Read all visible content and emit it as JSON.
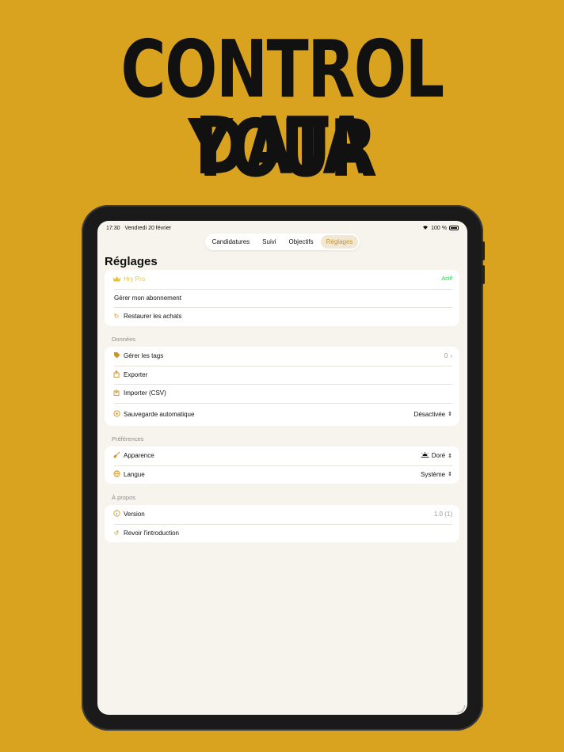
{
  "headline": {
    "line1": "CONTROL YOUR",
    "line2": "DATA"
  },
  "status_bar": {
    "time": "17:30",
    "date": "Vendredi 20 février",
    "battery": "100 %"
  },
  "tabs": [
    {
      "label": "Candidatures",
      "active": false
    },
    {
      "label": "Suivi",
      "active": false
    },
    {
      "label": "Objectifs",
      "active": false
    },
    {
      "label": "Réglages",
      "active": true
    }
  ],
  "page_title": "Réglages",
  "subscription": {
    "pro_label": "Hry Pro",
    "pro_status": "Actif",
    "manage_label": "Gérer mon abonnement",
    "restore_label": "Restaurer les achats"
  },
  "data_section": {
    "header": "Données",
    "tags_label": "Gérer les tags",
    "tags_count": "0",
    "export_label": "Exporter",
    "import_label": "Importer (CSV)",
    "autosave_label": "Sauvegarde automatique",
    "autosave_value": "Désactivée"
  },
  "preferences_section": {
    "header": "Préférences",
    "appearance_label": "Apparence",
    "appearance_value": "Doré",
    "language_label": "Langue",
    "language_value": "Système"
  },
  "about_section": {
    "header": "À propos",
    "version_label": "Version",
    "version_value": "1.0 (1)",
    "intro_label": "Revoir l'introduction"
  },
  "colors": {
    "background": "#D9A31F",
    "accent": "#C8952A",
    "active_green": "#34C759"
  }
}
